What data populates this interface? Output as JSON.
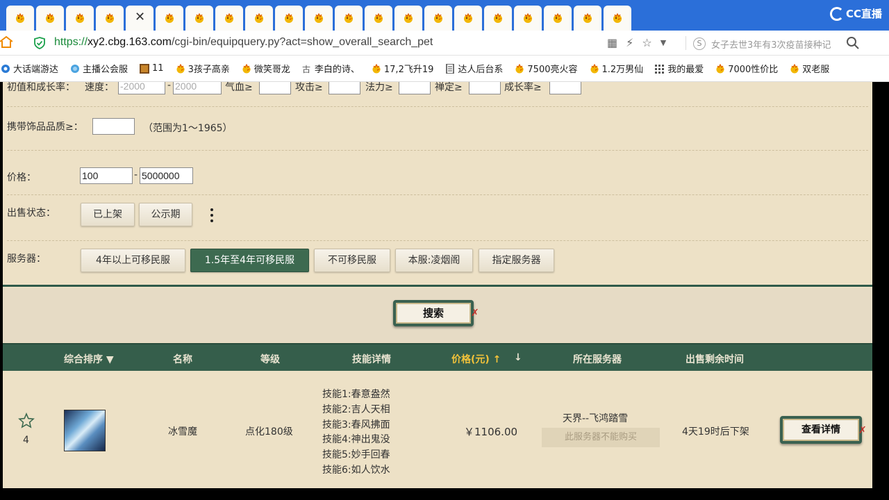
{
  "browser": {
    "tabs_count": 21,
    "active_tab_index": 4,
    "close_glyph": "✕",
    "cc_logo": "CC直播",
    "url_protocol": "https://",
    "url_host": "xy2.cbg.163.com",
    "url_path": "/cgi-bin/equipquery.py?act=show_overall_search_pet",
    "search_text": "女子去世3年有3次疫苗接种记",
    "search_icon_text": "S",
    "tool_icons": [
      "grid-icon",
      "bolt-icon",
      "star-icon",
      "dropdown-icon"
    ]
  },
  "bookmarks": [
    {
      "label": "大话端游达",
      "icon": "swirl"
    },
    {
      "label": "主播公会服",
      "icon": "cloud"
    },
    {
      "label": "11",
      "icon": "game"
    },
    {
      "label": "3孩子高亲",
      "icon": "chick"
    },
    {
      "label": "微笑哥龙",
      "icon": "chick"
    },
    {
      "label": "李白的诗、",
      "icon": "gu"
    },
    {
      "label": "17,2飞升19",
      "icon": "chick"
    },
    {
      "label": "达人后台系",
      "icon": "doc"
    },
    {
      "label": "7500亮火容",
      "icon": "chick"
    },
    {
      "label": "1.2万男仙",
      "icon": "chick"
    },
    {
      "label": "我的最爱",
      "icon": "apps"
    },
    {
      "label": "7000性价比",
      "icon": "chick"
    },
    {
      "label": "双老服",
      "icon": "chick"
    }
  ],
  "filters": {
    "growth_label": "初值和成长率：",
    "speed_label": "速度：",
    "speed_min": "-2000",
    "speed_max": "2000",
    "hp_label": "气血≥",
    "attack_label": "攻击≥",
    "mana_label": "法力≥",
    "focus_label": "禅定≥",
    "growth_rate_label": "成长率≥",
    "accessory_label": "携带饰品品质≥：",
    "accessory_hint": "（范围为1～1965）",
    "price_label": "价格：",
    "price_min": "100",
    "price_max": "5000000",
    "dash": "-",
    "status_label": "出售状态：",
    "status_buttons": [
      "已上架",
      "公示期"
    ],
    "server_label": "服务器：",
    "server_buttons": [
      "4年以上可移民服",
      "1.5年至4年可移民服",
      "不可移民服",
      "本服:凌烟阁",
      "指定服务器"
    ],
    "server_active_index": 1,
    "search_button": "搜索"
  },
  "table": {
    "headers": {
      "sort": "综合排序 ▼",
      "name": "名称",
      "level": "等级",
      "skills": "技能详情",
      "price": "价格(元)",
      "server": "所在服务器",
      "time_left": "出售剩余时间"
    },
    "price_sort_up": "↑",
    "price_sort_down": "↓",
    "rows": [
      {
        "fav_count": "4",
        "name": "冰雪魔",
        "level": "点化180级",
        "skills": [
          "技能1:春意盎然",
          "技能2:吉人天相",
          "技能3:春风拂面",
          "技能4:神出鬼没",
          "技能5:妙手回春",
          "技能6:如人饮水"
        ],
        "price": "￥1106.00",
        "server": "天界--飞鸿踏雪",
        "server_note": "此服务器不能购买",
        "time_left": "4天19时后下架",
        "detail_button": "查看详情"
      }
    ]
  },
  "colors": {
    "tabbar": "#2b6fd9",
    "page_bg": "#ede1c6",
    "header_green": "#355e4b",
    "active_green": "#3d6a50",
    "price_gold": "#f2c23a"
  }
}
